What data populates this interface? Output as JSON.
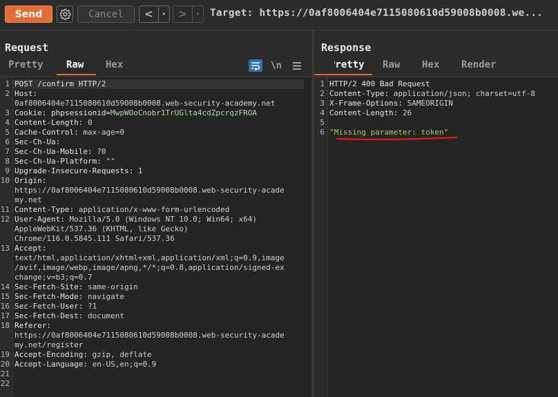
{
  "toolbar": {
    "send_label": "Send",
    "cancel_label": "Cancel",
    "back_icon": "<",
    "forward_icon": ">",
    "dropdown_icon": "▾",
    "target_text": "Target: https://0af8006404e7115080610d59008b0008.we..."
  },
  "request": {
    "title": "Request",
    "tabs": [
      "Pretty",
      "Raw",
      "Hex"
    ],
    "active_tab": "Raw",
    "newline_toggle": "\\n",
    "lines": [
      {
        "n": "1",
        "k": "POST /confirm HTTP/2",
        "v": ""
      },
      {
        "n": "2",
        "k": "Host:",
        "v": ""
      },
      {
        "n": "",
        "k": "",
        "v": "0af8006404e7115080610d59008b0008.web-security-academy.net"
      },
      {
        "n": "3",
        "k": "Cookie: phpsessionid=",
        "v": "MwpWOoCnobr1TrUGlta4cdZpcrqzFROA",
        "cookie": true
      },
      {
        "n": "4",
        "k": "Content-Length:",
        "v": " 0"
      },
      {
        "n": "5",
        "k": "Cache-Control:",
        "v": " max-age=0"
      },
      {
        "n": "6",
        "k": "Sec-Ch-Ua:",
        "v": ""
      },
      {
        "n": "7",
        "k": "Sec-Ch-Ua-Mobile:",
        "v": " ?0"
      },
      {
        "n": "8",
        "k": "Sec-Ch-Ua-Platform:",
        "v": " \"\""
      },
      {
        "n": "9",
        "k": "Upgrade-Insecure-Requests:",
        "v": " 1"
      },
      {
        "n": "10",
        "k": "Origin:",
        "v": ""
      },
      {
        "n": "",
        "k": "",
        "v": "https://0af8006404e7115080610d59008b0008.web-security-acade"
      },
      {
        "n": "",
        "k": "",
        "v": "my.net"
      },
      {
        "n": "11",
        "k": "Content-Type:",
        "v": " application/x-www-form-urlencoded"
      },
      {
        "n": "12",
        "k": "User-Agent:",
        "v": " Mozilla/5.0 (Windows NT 10.0; Win64; x64)"
      },
      {
        "n": "",
        "k": "",
        "v": "AppleWebKit/537.36 (KHTML, like Gecko)"
      },
      {
        "n": "",
        "k": "",
        "v": "Chrome/116.0.5845.111 Safari/537.36"
      },
      {
        "n": "13",
        "k": "Accept:",
        "v": ""
      },
      {
        "n": "",
        "k": "",
        "v": "text/html,application/xhtml+xml,application/xml;q=0.9,image"
      },
      {
        "n": "",
        "k": "",
        "v": "/avif,image/webp,image/apng,*/*;q=0.8,application/signed-ex"
      },
      {
        "n": "",
        "k": "",
        "v": "change;v=b3;q=0.7"
      },
      {
        "n": "14",
        "k": "Sec-Fetch-Site:",
        "v": " same-origin"
      },
      {
        "n": "15",
        "k": "Sec-Fetch-Mode:",
        "v": " navigate"
      },
      {
        "n": "16",
        "k": "Sec-Fetch-User:",
        "v": " ?1"
      },
      {
        "n": "17",
        "k": "Sec-Fetch-Dest:",
        "v": " document"
      },
      {
        "n": "18",
        "k": "Referer:",
        "v": ""
      },
      {
        "n": "",
        "k": "",
        "v": "https://0af8006404e7115080610d59008b0008.web-security-acade"
      },
      {
        "n": "",
        "k": "",
        "v": "my.net/register"
      },
      {
        "n": "19",
        "k": "Accept-Encoding:",
        "v": " gzip, deflate"
      },
      {
        "n": "20",
        "k": "Accept-Language:",
        "v": " en-US,en;q=0.9"
      },
      {
        "n": "21",
        "k": "",
        "v": ""
      },
      {
        "n": "22",
        "k": "",
        "v": ""
      }
    ]
  },
  "response": {
    "title": "Response",
    "tabs": [
      "Pretty",
      "Raw",
      "Hex",
      "Render"
    ],
    "active_tab": "Pretty",
    "lines": [
      {
        "n": "1",
        "k": "HTTP/2 400 Bad Request",
        "v": ""
      },
      {
        "n": "2",
        "k": "Content-Type:",
        "v": " application/json; charset=utf-8"
      },
      {
        "n": "3",
        "k": "X-Frame-Options:",
        "v": " SAMEORIGIN"
      },
      {
        "n": "4",
        "k": "Content-Length:",
        "v": " 26"
      },
      {
        "n": "5",
        "k": "",
        "v": ""
      },
      {
        "n": "6",
        "k": "",
        "v": "\"Missing parameter: token\"",
        "str": true
      }
    ]
  },
  "colors": {
    "accent": "#e36b34",
    "annotation": "#e01b1b"
  }
}
